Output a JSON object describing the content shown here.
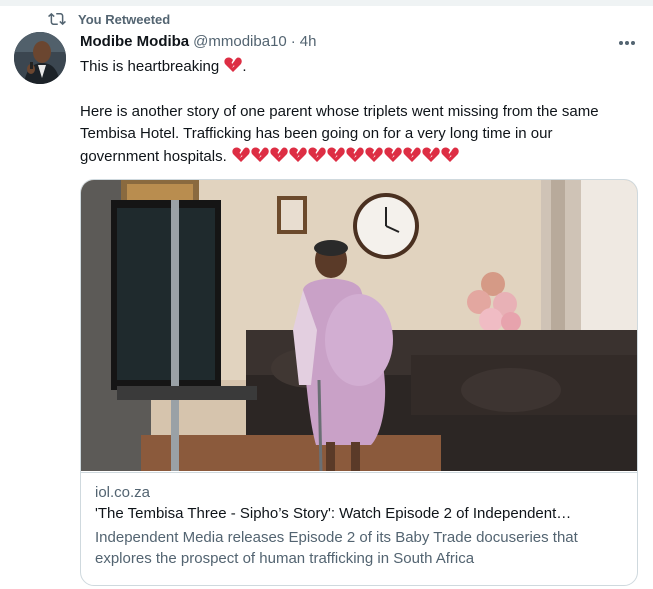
{
  "retweet": {
    "label": "You Retweeted",
    "icon": "retweet-icon"
  },
  "tweet": {
    "author_name": "Modibe Modiba",
    "handle": "@mmodiba10",
    "separator": "·",
    "time": "4h",
    "more_icon": "more-options-icon",
    "line1": "This is heartbreaking",
    "line1_end": ".",
    "body": "Here is another story of one parent whose triplets went missing from the same Tembisa Hotel. Trafficking has been going on for a very long time in our government hospitals.",
    "broken_heart_count": 12,
    "heart_color": "#dd2e44"
  },
  "card": {
    "image_icon": "link-preview-image",
    "domain": "iol.co.za",
    "title": "'The Tembisa Three - Sipho’s Story': Watch Episode 2 of Independent…",
    "description": "Independent Media releases Episode 2 of its Baby Trade docuseries that explores the prospect of human trafficking in South Africa"
  },
  "colors": {
    "text_primary": "#0f1419",
    "text_secondary": "#536471",
    "border": "#cfd9de"
  }
}
